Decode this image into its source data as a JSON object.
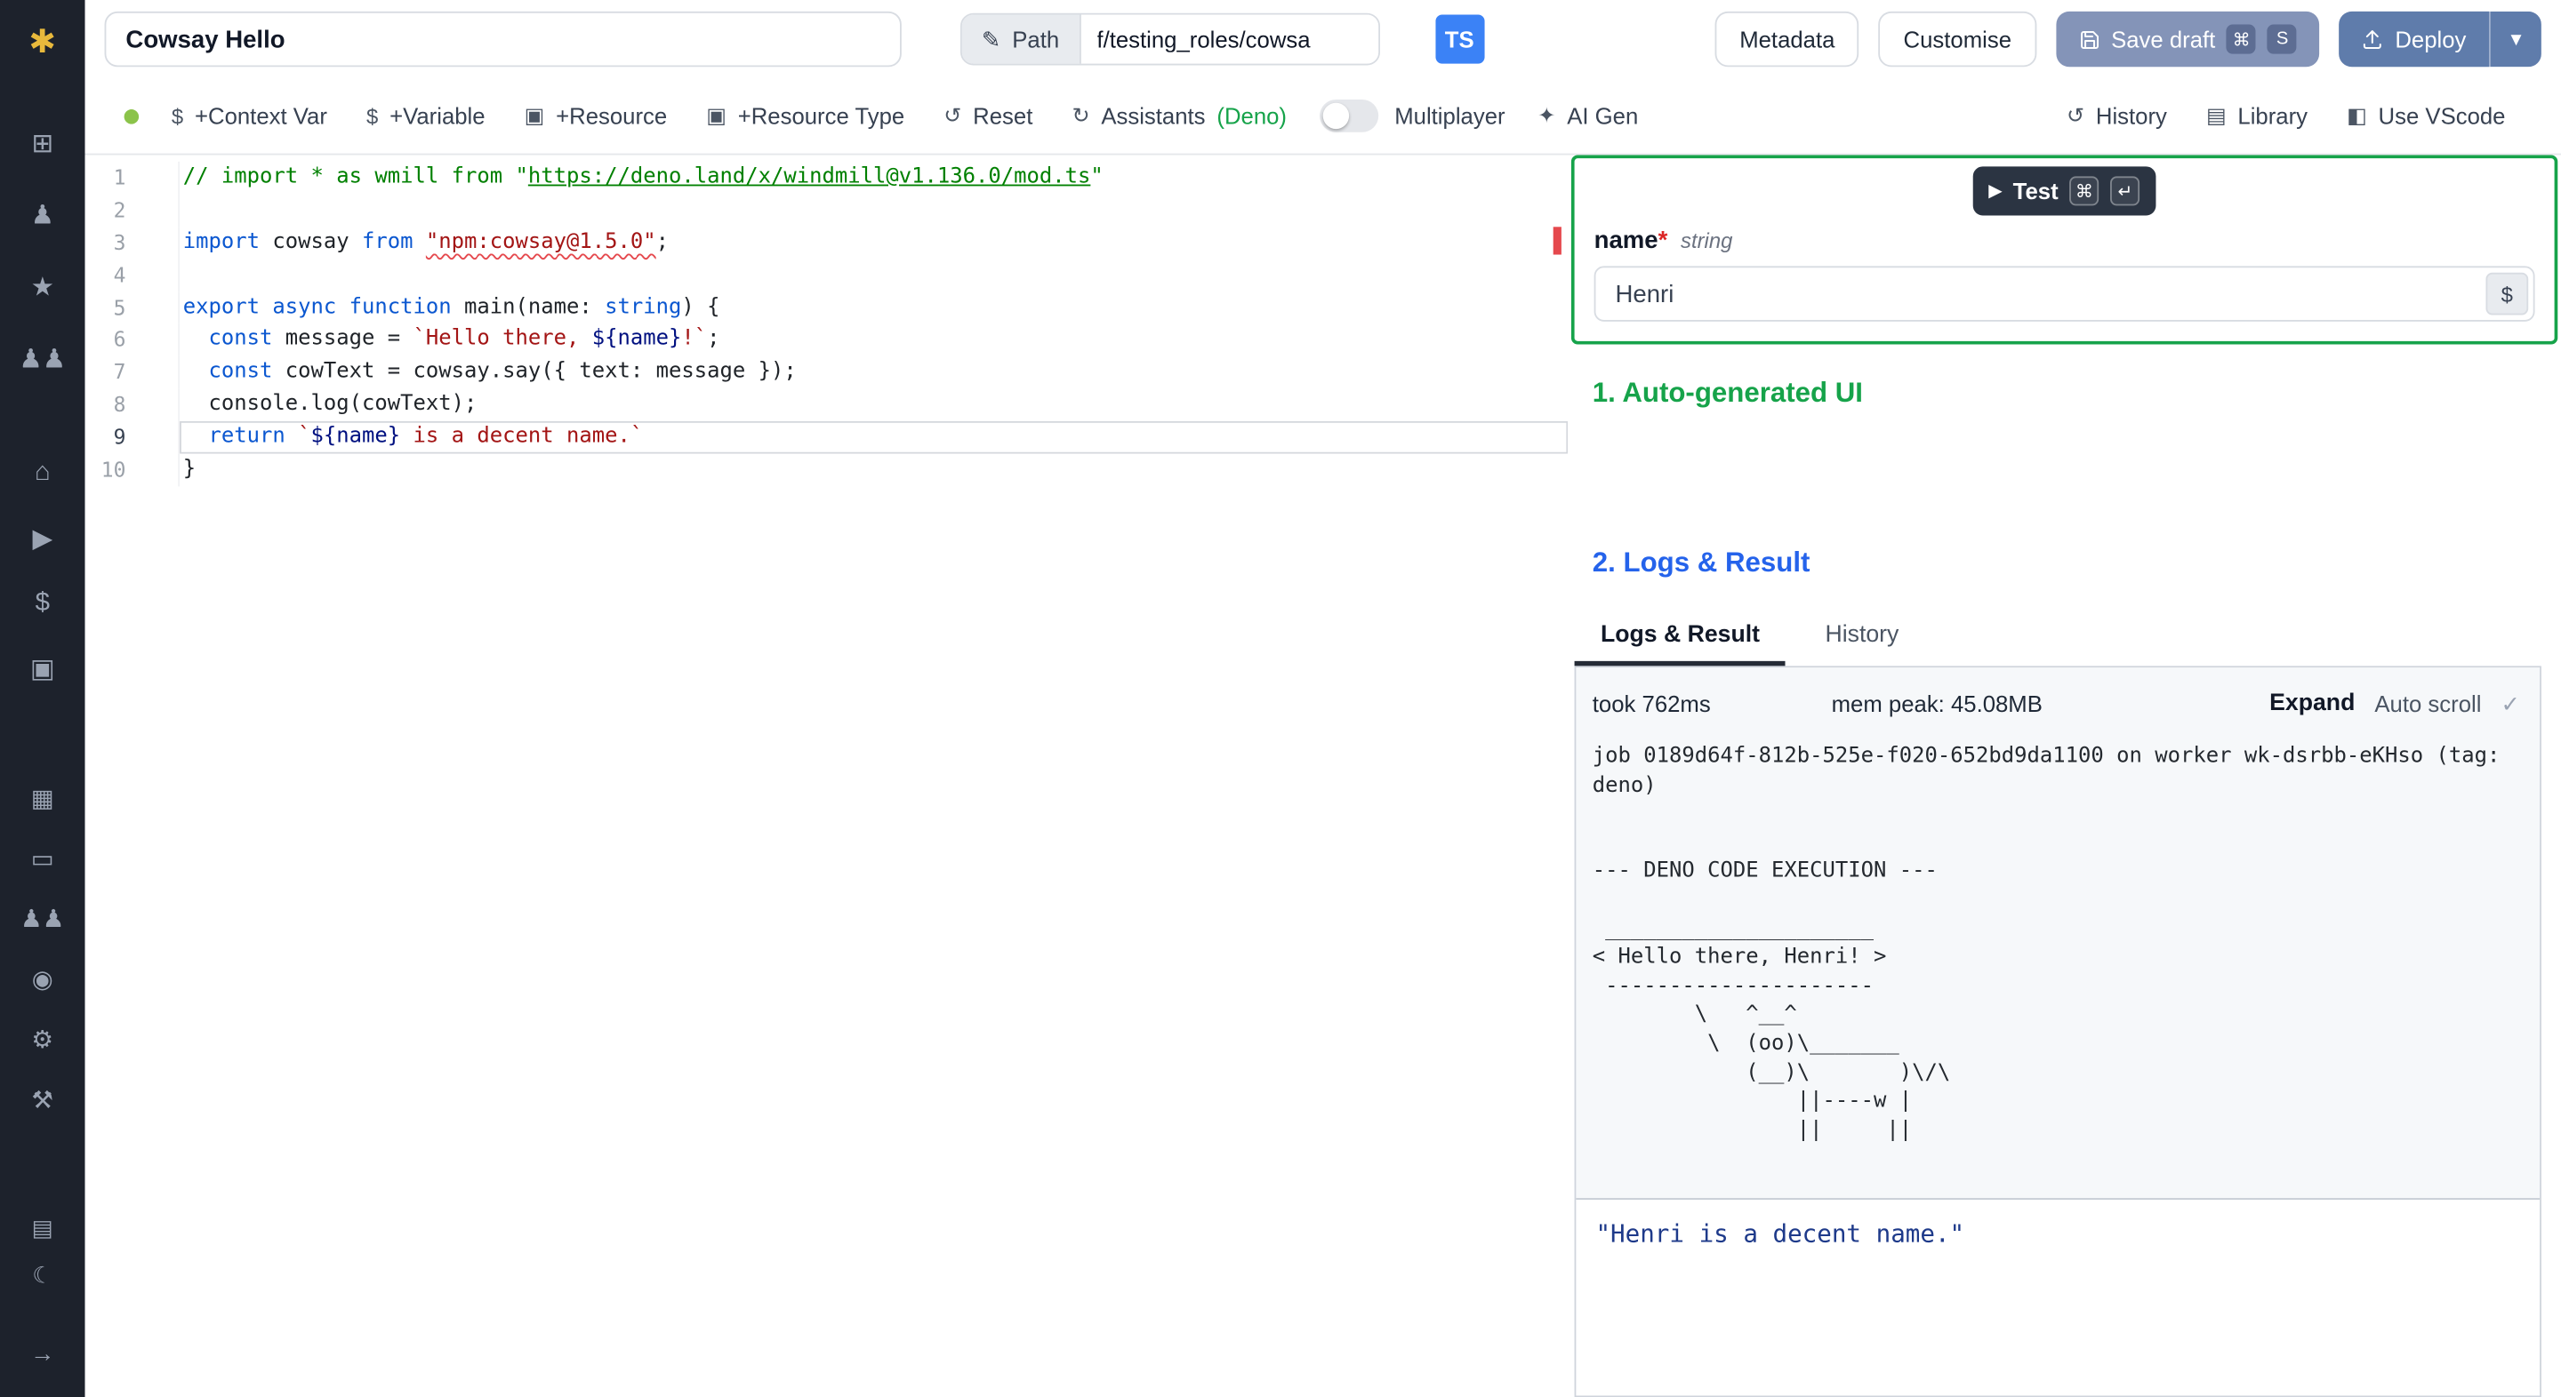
{
  "colors": {
    "sidebar_bg": "#1d222c",
    "logo_yellow": "#e8b93c",
    "badge_blue": "#3b82f6",
    "save_draft_bg": "#8494b8",
    "save_kbd_bg": "#5d6d93",
    "deploy_bg": "#5f7cab",
    "status_green": "#8bc34a",
    "accent_green": "#16a34a",
    "accent_blue": "#2563eb",
    "error_red": "#e5484d",
    "test_btn_bg": "#2b3442",
    "result_text": "#1e3a8a"
  },
  "topbar": {
    "script_name": "Cowsay Hello",
    "path_label": "Path",
    "path_value": "f/testing_roles/cowsa",
    "lang_badge": "TS",
    "metadata_label": "Metadata",
    "customise_label": "Customise",
    "save_draft_label": "Save draft",
    "save_shortcut_keys": [
      "⌘",
      "S"
    ],
    "deploy_label": "Deploy"
  },
  "toolbar": {
    "buttons": [
      {
        "name": "add-context-var-button",
        "icon": "dollar-icon",
        "glyph": "$",
        "label": "+Context Var"
      },
      {
        "name": "add-variable-button",
        "icon": "dollar-icon",
        "glyph": "$",
        "label": "+Variable"
      },
      {
        "name": "add-resource-button",
        "icon": "package-icon",
        "glyph": "▣",
        "label": "+Resource"
      },
      {
        "name": "add-resource-type-button",
        "icon": "package-icon",
        "glyph": "▣",
        "label": "+Resource Type"
      },
      {
        "name": "reset-button",
        "icon": "reset-icon",
        "glyph": "↺",
        "label": "Reset"
      },
      {
        "name": "assistants-button",
        "icon": "refresh-icon",
        "glyph": "↻",
        "label": "Assistants",
        "suffix": "(Deno)"
      }
    ],
    "multiplayer_label": "Multiplayer",
    "multiplayer_enabled": false,
    "ai_gen_label": "AI Gen",
    "right_buttons": [
      {
        "name": "history-button",
        "icon": "history-icon",
        "glyph": "↺",
        "label": "History"
      },
      {
        "name": "library-button",
        "icon": "library-icon",
        "glyph": "▤",
        "label": "Library"
      },
      {
        "name": "use-vscode-button",
        "icon": "vscode-icon",
        "glyph": "◧",
        "label": "Use VScode"
      }
    ]
  },
  "sidebar": {
    "logo_glyph": "✱",
    "groups": [
      [
        {
          "name": "grid-icon",
          "glyph": "⊞"
        },
        {
          "name": "user-icon",
          "glyph": "♟"
        },
        {
          "name": "star-icon",
          "glyph": "★"
        },
        {
          "name": "users-icon",
          "glyph": "♟♟"
        }
      ],
      [
        {
          "name": "home-icon",
          "glyph": "⌂"
        },
        {
          "name": "runs-play-icon",
          "glyph": "▶"
        },
        {
          "name": "variables-dollar-icon",
          "glyph": "$"
        },
        {
          "name": "resources-boxes-icon",
          "glyph": "▣"
        }
      ],
      [
        {
          "name": "schedules-calendar-icon",
          "glyph": "▦"
        },
        {
          "name": "folders-icon",
          "glyph": "▭"
        },
        {
          "name": "groups-icon",
          "glyph": "♟♟"
        },
        {
          "name": "audit-eye-icon",
          "glyph": "◉"
        },
        {
          "name": "settings-gear-icon",
          "glyph": "⚙"
        },
        {
          "name": "workers-icon",
          "glyph": "⚒"
        }
      ],
      [
        {
          "name": "docs-icon",
          "glyph": "▤"
        },
        {
          "name": "dark-mode-moon-icon",
          "glyph": "☾"
        }
      ],
      [
        {
          "name": "expand-sidebar-arrow-icon",
          "glyph": "→"
        }
      ]
    ]
  },
  "editor": {
    "active_line": 9,
    "error_line": 3,
    "diagnostic_token": "npm:cowsay@1.5.0",
    "lines": [
      "// import * as wmill from \"https://deno.land/x/windmill@v1.136.0/mod.ts\"",
      "",
      "import cowsay from \"npm:cowsay@1.5.0\";",
      "",
      "export async function main(name: string) {",
      "  const message = `Hello there, ${name}!`;",
      "  const cowText = cowsay.say({ text: message });",
      "  console.log(cowText);",
      "  return `${name} is a decent name.`",
      "}"
    ]
  },
  "right_panel": {
    "test_button": {
      "label": "Test",
      "shortcut_keys": [
        "⌘",
        "↵"
      ]
    },
    "arg": {
      "label": "name",
      "required_mark": "*",
      "type": "string",
      "value": "Henri",
      "adornment": "$"
    },
    "section1_title": "1. Auto-generated UI",
    "section2_title": "2. Logs & Result",
    "tabs": [
      {
        "label": "Logs & Result",
        "active": true
      },
      {
        "label": "History",
        "active": false
      }
    ],
    "stats": {
      "took": "took 762ms",
      "mem_peak": "mem peak: 45.08MB",
      "expand_label": "Expand",
      "autoscroll_label": "Auto scroll"
    },
    "log_lines": [
      "job 0189d64f-812b-525e-f020-652bd9da1100 on worker wk-dsrbb-eKHso (tag: deno)",
      "",
      "",
      "--- DENO CODE EXECUTION ---",
      "",
      " _____________________",
      "< Hello there, Henri! >",
      " ---------------------",
      "        \\   ^__^",
      "         \\  (oo)\\_______",
      "            (__)\\       )\\/\\",
      "                ||----w |",
      "                ||     ||"
    ],
    "result": "\"Henri is a decent name.\""
  },
  "icons": {
    "pencil": "✎",
    "chevron_down": "▾",
    "play": "▶",
    "check": "✓",
    "wand": "✦"
  }
}
